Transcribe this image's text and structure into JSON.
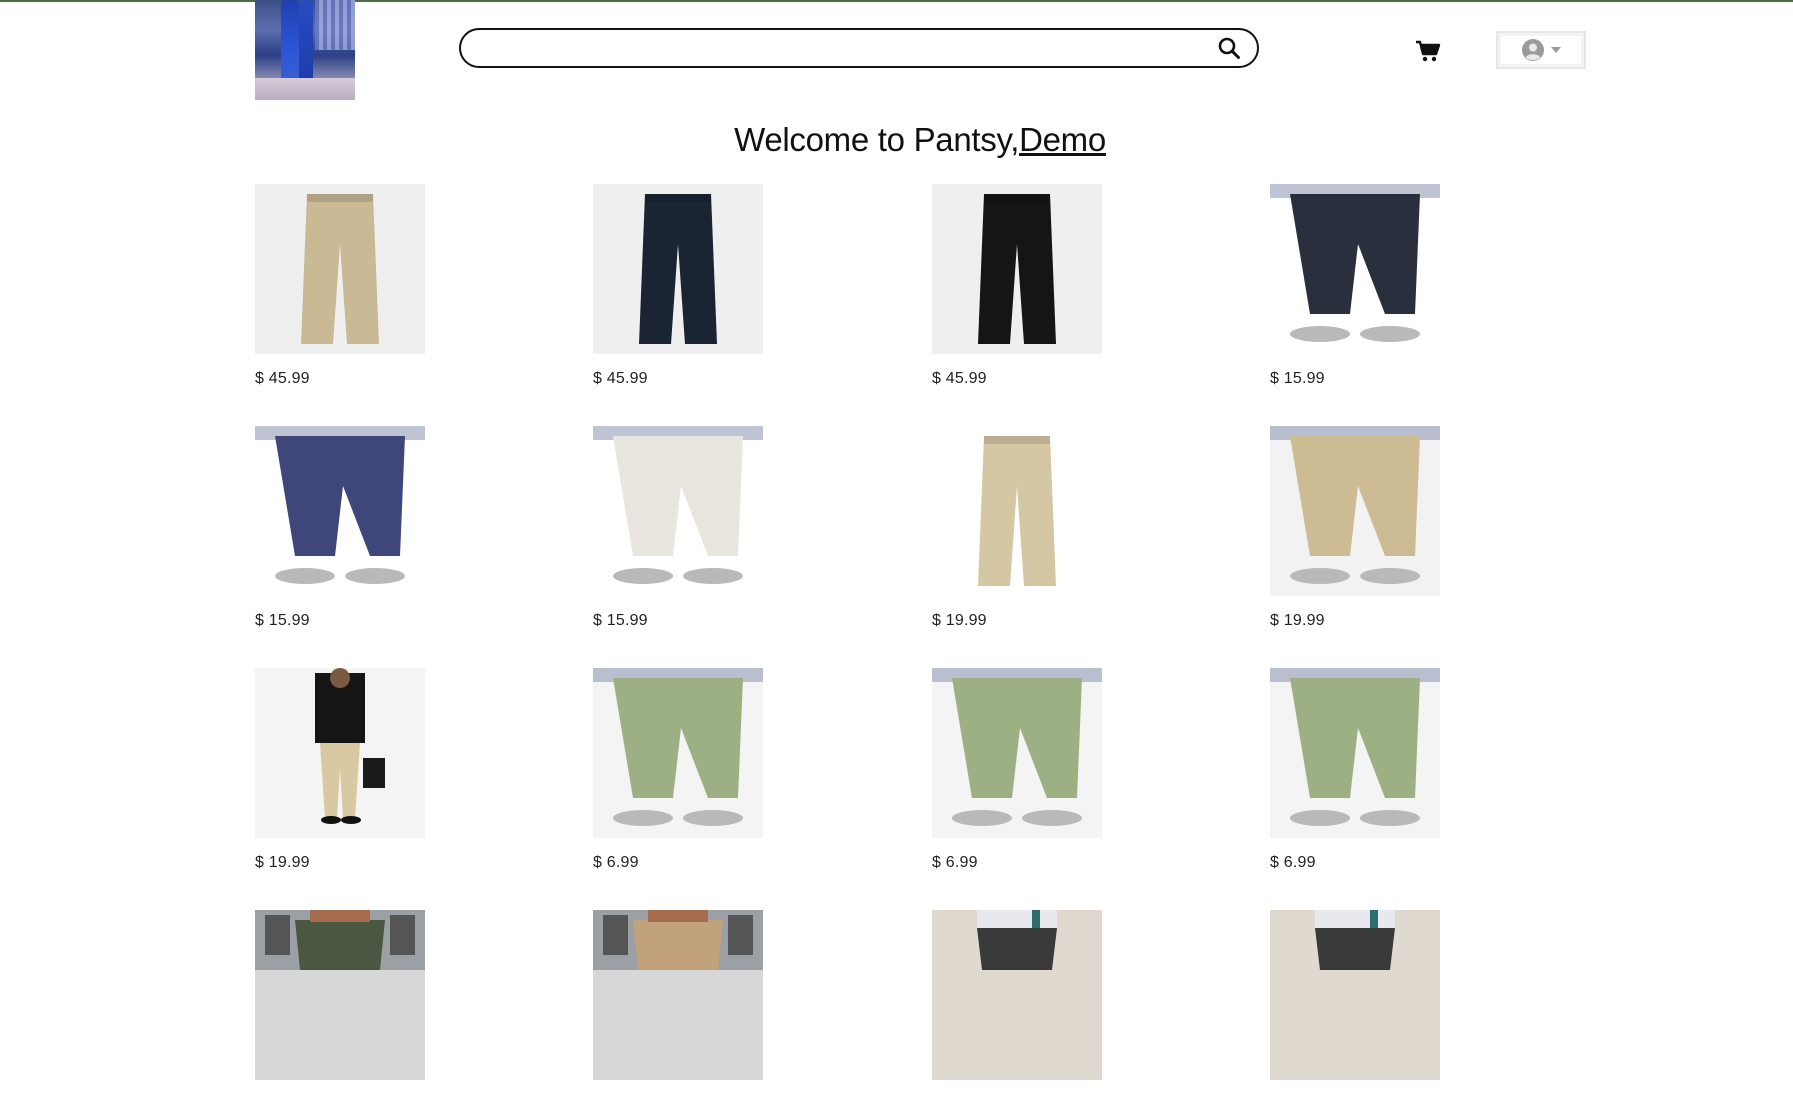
{
  "header": {
    "logo_icon": "brand-logo-jeans-photo",
    "search_placeholder": "",
    "search_value": "",
    "search_icon": "search-icon",
    "cart_icon": "cart-icon",
    "account_icon": "user-avatar-icon"
  },
  "welcome": {
    "prefix": "Welcome to Pantsy,",
    "username": "Demo"
  },
  "products": [
    {
      "price": "$ 45.99",
      "color": "#c9b995",
      "bg": "#efefef",
      "style": "flat"
    },
    {
      "price": "$ 45.99",
      "color": "#1a2433",
      "bg": "#efefef",
      "style": "flat"
    },
    {
      "price": "$ 45.99",
      "color": "#151515",
      "bg": "#efefef",
      "style": "flat"
    },
    {
      "price": "$ 15.99",
      "color": "#2a2f3d",
      "bg": "#ffffff",
      "style": "worn"
    },
    {
      "price": "$ 15.99",
      "color": "#3f4679",
      "bg": "#ffffff",
      "style": "worn"
    },
    {
      "price": "$ 15.99",
      "color": "#e8e6df",
      "bg": "#ffffff",
      "style": "worn"
    },
    {
      "price": "$ 19.99",
      "color": "#d6c7a4",
      "bg": "#ffffff",
      "style": "flat"
    },
    {
      "price": "$ 19.99",
      "color": "#cdbb93",
      "bg": "#f2f2f2",
      "style": "worn"
    },
    {
      "price": "$ 19.99",
      "color": "#d9c9a3",
      "bg": "#f4f4f4",
      "style": "model"
    },
    {
      "price": "$ 6.99",
      "color": "#9cb084",
      "bg": "#f4f4f4",
      "style": "worn"
    },
    {
      "price": "$ 6.99",
      "color": "#9cb084",
      "bg": "#f4f4f4",
      "style": "worn"
    },
    {
      "price": "$ 6.99",
      "color": "#9cb084",
      "bg": "#f4f4f4",
      "style": "worn"
    },
    {
      "price": "",
      "color": "#4b5740",
      "bg": "#d7d7d7",
      "style": "street"
    },
    {
      "price": "",
      "color": "#c2a27a",
      "bg": "#d7d7d7",
      "style": "street"
    },
    {
      "price": "",
      "color": "#3a3a3a",
      "bg": "#e0d9cf",
      "style": "pleat"
    },
    {
      "price": "",
      "color": "#3a3a3a",
      "bg": "#e0d9cf",
      "style": "pleat"
    }
  ]
}
